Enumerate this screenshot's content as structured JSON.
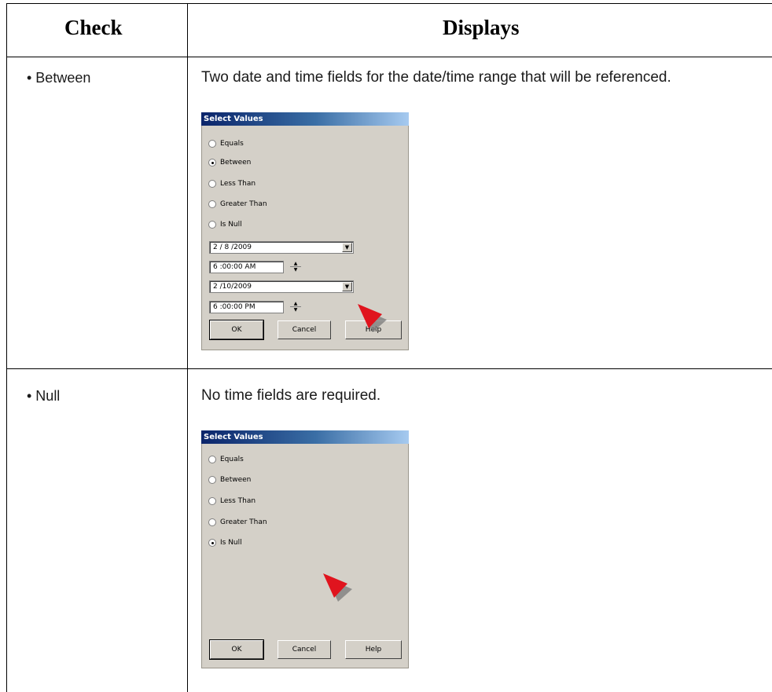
{
  "header": {
    "check": "Check",
    "displays": "Displays"
  },
  "rows": [
    {
      "check": "• Between",
      "description": "Two date and time fields for the date/time range that will be referenced.",
      "dialog": {
        "title": "Select Values",
        "options": [
          "Equals",
          "Between",
          "Less Than",
          "Greater Than",
          "Is Null"
        ],
        "selected_option": "Between",
        "start_date": "2 / 8 /2009",
        "start_time": "6 :00:00 AM",
        "end_date": "2 /10/2009",
        "end_time": "6 :00:00 PM",
        "buttons": {
          "ok": "OK",
          "cancel": "Cancel",
          "help": "Help"
        }
      }
    },
    {
      "check": "• Null",
      "description": "No time fields are required.",
      "dialog": {
        "title": "Select Values",
        "options": [
          "Equals",
          "Between",
          "Less Than",
          "Greater Than",
          "Is Null"
        ],
        "selected_option": "Is Null",
        "buttons": {
          "ok": "OK",
          "cancel": "Cancel",
          "help": "Help"
        }
      }
    }
  ],
  "icons": {
    "dropdown": "dropdown-arrow-icon",
    "spinner": "spinner-icon",
    "cursor": "red-arrow-cursor-icon"
  },
  "colors": {
    "dialog_bg": "#d4d0c8",
    "title_start": "#0a246a",
    "title_end": "#a6caf0",
    "cursor": "#e0141e"
  }
}
